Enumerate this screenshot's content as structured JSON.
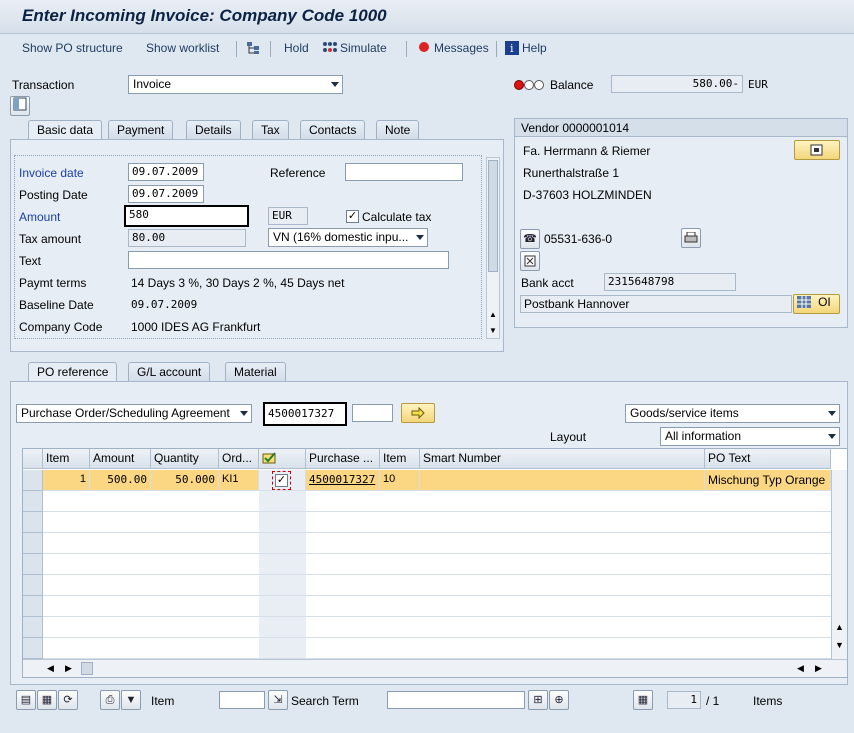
{
  "title": "Enter Incoming Invoice: Company Code 1000",
  "toolbar": {
    "show_po_structure": "Show PO structure",
    "show_worklist": "Show worklist",
    "hold": "Hold",
    "simulate": "Simulate",
    "messages": "Messages",
    "help": "Help"
  },
  "transaction": {
    "label": "Transaction",
    "value": "Invoice"
  },
  "balance": {
    "label": "Balance",
    "value": "580.00-",
    "currency": "EUR"
  },
  "tabs": [
    "Basic data",
    "Payment",
    "Details",
    "Tax",
    "Contacts",
    "Note"
  ],
  "basic": {
    "invoice_date_label": "Invoice date",
    "invoice_date": "09.07.2009",
    "reference_label": "Reference",
    "reference": "",
    "posting_date_label": "Posting Date",
    "posting_date": "09.07.2009",
    "amount_label": "Amount",
    "amount": "580",
    "currency": "EUR",
    "calculate_tax_label": "Calculate tax",
    "tax_amount_label": "Tax amount",
    "tax_amount": "80.00",
    "tax_code": "VN (16% domestic inpu...",
    "text_label": "Text",
    "text": "",
    "payment_terms_label": "Paymt terms",
    "payment_terms": "14 Days 3 %, 30 Days 2 %, 45 Days net",
    "baseline_date_label": "Baseline Date",
    "baseline_date": "09.07.2009",
    "company_code_label": "Company Code",
    "company_code": "1000 IDES AG Frankfurt"
  },
  "vendor": {
    "header": "Vendor 0000001014",
    "name": "Fa. Herrmann & Riemer",
    "street": "Runerthalstraße 1",
    "city": "D-37603 HOLZMINDEN",
    "phone": "05531-636-0",
    "bank_acct_label": "Bank acct",
    "bank_acct": "2315648798",
    "bank_name": "Postbank Hannover",
    "oi_label": "OI"
  },
  "lower_tabs": [
    "PO reference",
    "G/L account",
    "Material"
  ],
  "po": {
    "doc_type": "Purchase Order/Scheduling Agreement",
    "po_number": "4500017327",
    "items_dropdown": "Goods/service items",
    "layout_label": "Layout",
    "layout": "All information"
  },
  "grid": {
    "columns": [
      "Item",
      "Amount",
      "Quantity",
      "Ord...",
      "",
      "Purchase ...",
      "Item",
      "Smart Number",
      "PO Text"
    ],
    "rows": [
      {
        "item": "1",
        "amount": "500.00",
        "quantity": "50.000",
        "order_unit": "KI1",
        "checked": true,
        "purchase_order": "4500017327",
        "po_item": "10",
        "smart_number": "",
        "po_text": "Mischung Typ Orange"
      }
    ]
  },
  "footer": {
    "item_label": "Item",
    "search_term_label": "Search Term",
    "page_current": "1",
    "page_total": "/ 1",
    "items_label": "Items"
  },
  "colors": {
    "accent": "#1b3fa6",
    "highlight_row": "#fbd783",
    "panel": "#e6edf4"
  }
}
